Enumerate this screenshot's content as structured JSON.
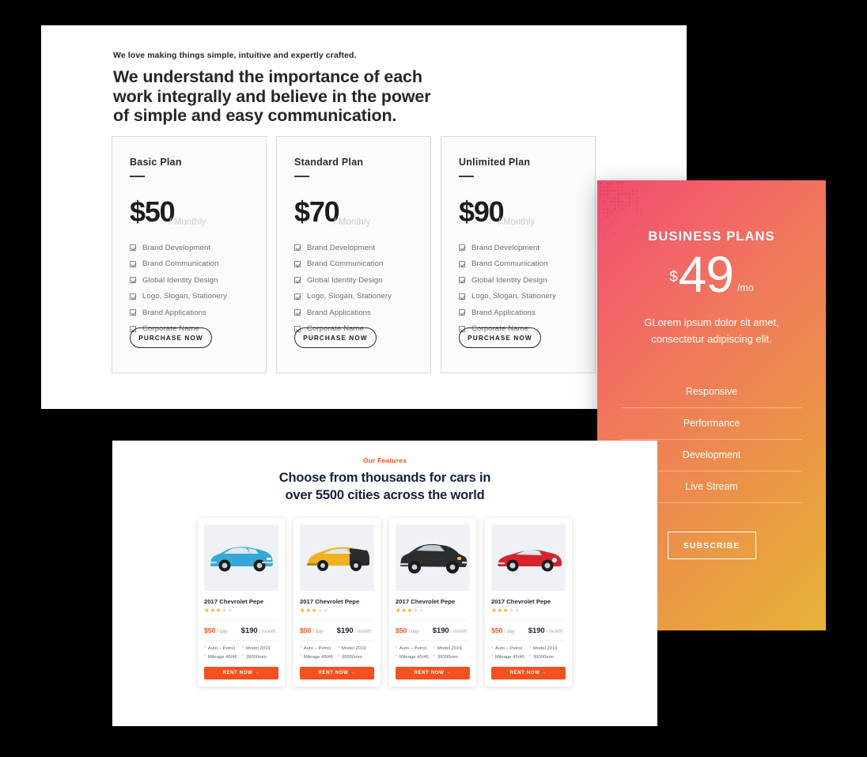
{
  "intro": {
    "eyebrow": "We love making things simple, intuitive and expertly crafted.",
    "heading": "We understand the importance of each work integrally and believe in the power of simple and easy communication."
  },
  "plans": {
    "period_label": "/ Monthly",
    "cta_label": "PURCHASE NOW",
    "features": [
      "Brand Development",
      "Brand Communication",
      "Global Identity Design",
      "Logo, Slogan, Stationery",
      "Brand Applications",
      "Corporate Name"
    ],
    "items": [
      {
        "name": "Basic Plan",
        "price": "$50"
      },
      {
        "name": "Standard Plan",
        "price": "$70"
      },
      {
        "name": "Unlimited Plan",
        "price": "$90"
      }
    ]
  },
  "business_card": {
    "title": "BUSINESS PLANS",
    "currency": "$",
    "amount": "49",
    "per": "/mo",
    "description": "GLorem ipsum dolor sit amet, consectetur adipiscing elit.",
    "features": [
      "Responsive",
      "Performance",
      "Development",
      "Live Stream"
    ],
    "cta_label": "SUBSCRIBE",
    "gradient_start": "#ef4a6e",
    "gradient_end": "#e8b339"
  },
  "features_section": {
    "eyebrow": "Our Features",
    "title_line1": "Choose from thousands for cars in",
    "title_line2": "over 5500 cities across the world",
    "accent_color": "#f4511e"
  },
  "cars": {
    "cta_label": "RENT NOW  →",
    "items": [
      {
        "name": "2017 Chevrolet Pepe",
        "rating": 3,
        "rating_max": 5,
        "price_day": "$50",
        "price_day_unit": "/ day",
        "price_month": "$190",
        "price_month_unit": "/ month",
        "spec_1": "Auto – Petrol",
        "spec_2": "Model 2019",
        "spec_3": "Mileage 45/46",
        "spec_4": "35000mm",
        "color": "#35a8d8",
        "body": "sedan"
      },
      {
        "name": "2017 Chevrolet Pepe",
        "rating": 3,
        "rating_max": 5,
        "price_day": "$50",
        "price_day_unit": "/ day",
        "price_month": "$190",
        "price_month_unit": "/ month",
        "spec_1": "Auto – Petrol",
        "spec_2": "Model 2019",
        "spec_3": "Mileage 45/46",
        "spec_4": "35000mm",
        "color": "#f2b01e",
        "body": "coupe"
      },
      {
        "name": "2017 Chevrolet Pepe",
        "rating": 3,
        "rating_max": 5,
        "price_day": "$50",
        "price_day_unit": "/ day",
        "price_month": "$190",
        "price_month_unit": "/ month",
        "spec_1": "Auto – Petrol",
        "spec_2": "Model 2019",
        "spec_3": "Mileage 45/46",
        "spec_4": "35000mm",
        "color": "#2d2d2d",
        "body": "classic"
      },
      {
        "name": "2017 Chevrolet Pepe",
        "rating": 3,
        "rating_max": 5,
        "price_day": "$50",
        "price_day_unit": "/ day",
        "price_month": "$190",
        "price_month_unit": "/ month",
        "spec_1": "Auto – Petrol",
        "spec_2": "Model 2019",
        "spec_3": "Mileage 45/46",
        "spec_4": "35000mm",
        "color": "#d6232a",
        "body": "convertible"
      }
    ]
  }
}
